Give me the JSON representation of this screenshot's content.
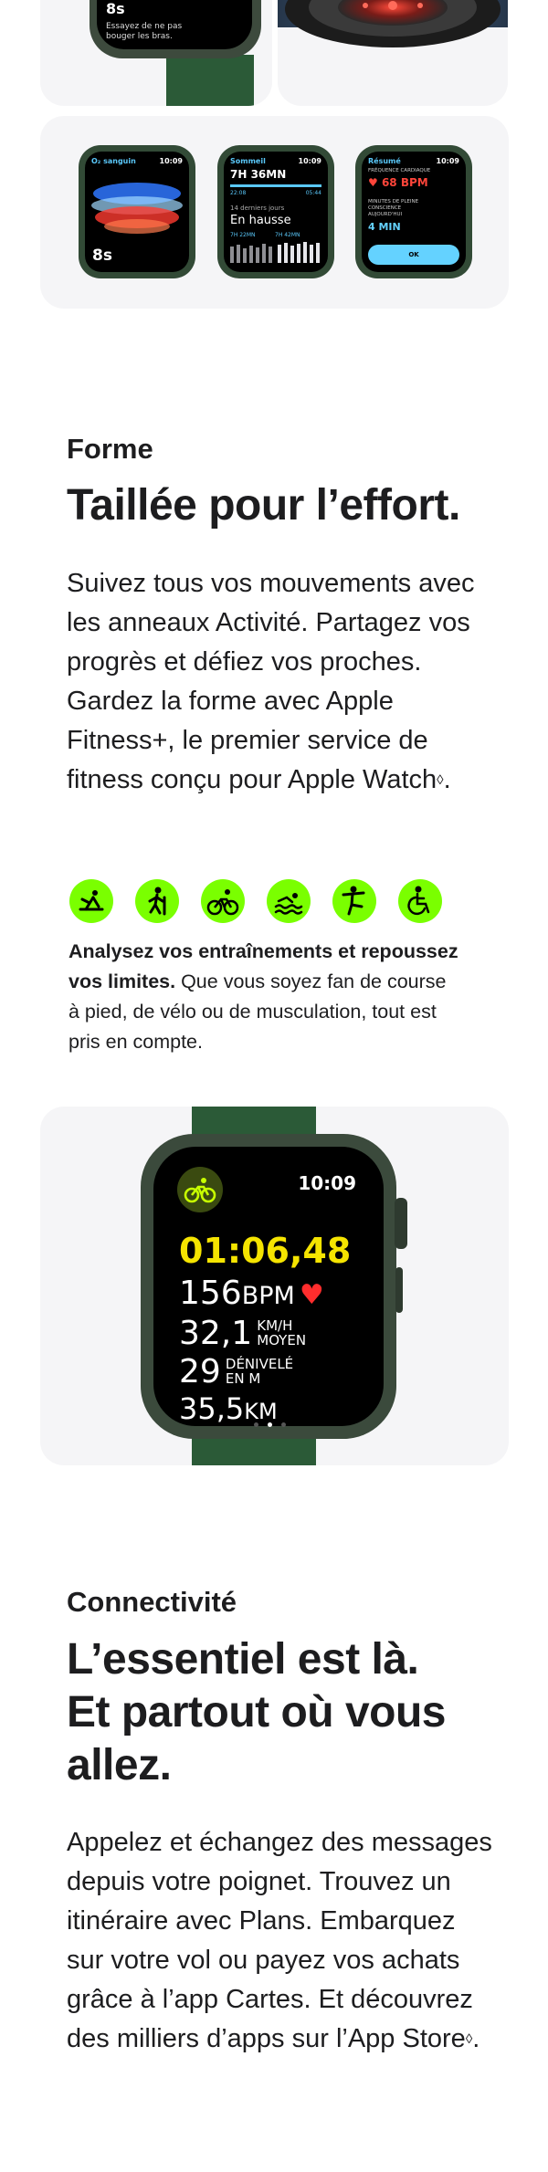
{
  "top_card_left": {
    "timer": "8s",
    "hint": "Essayez de ne pas bouger les bras."
  },
  "small_watches": [
    {
      "title": "O₂ sanguin",
      "time": "10:09",
      "timer": "8s"
    },
    {
      "title": "Sommeil",
      "time": "10:09",
      "duration": "7H 36MN",
      "range_start": "22:08",
      "range_end": "05:44",
      "subtitle": "14 derniers jours",
      "trend": "En hausse",
      "stat1": "7H 22MN",
      "stat2": "7H 42MN"
    },
    {
      "title": "Résumé",
      "time": "10:09",
      "label1": "FRÉQUENCE CARDIAQUE",
      "bpm": "68 BPM",
      "label2": "MINUTES DE PLEINE CONSCIENCE AUJOURD'HUI",
      "minutes": "4 MIN",
      "button": "OK"
    }
  ],
  "fitness": {
    "eyebrow": "Forme",
    "headline": "Taillée pour l’effort.",
    "body": "Suivez tous vos mouvements avec les anneaux Activité. Partagez vos progrès et défiez vos proches. Gardez la forme avec Apple Fitness+, le premier service de fitness conçu pour Apple Watch",
    "body_mark": "◊",
    "body_end": ".",
    "icons": [
      "yoga-icon",
      "hiking-icon",
      "cycling-icon",
      "swimming-icon",
      "dance-icon",
      "wheelchair-icon"
    ],
    "caption_bold": "Analysez vos entraînements et repoussez vos limites.",
    "caption_rest": " Que vous soyez fan de course à pied, de vélo ou de musculation, tout est pris en compte."
  },
  "workout_watch": {
    "time": "10:09",
    "elapsed": "01:06,48",
    "bpm_value": "156",
    "bpm_unit": "BPM",
    "speed_value": "32,1",
    "speed_unit_top": "KM/H",
    "speed_unit_bottom": "MOYEN",
    "elevation_value": "29",
    "elevation_unit_top": "DÉNIVELÉ",
    "elevation_unit_bottom": "EN M",
    "distance_value": "35,5",
    "distance_unit": "KM"
  },
  "connectivity": {
    "eyebrow": "Connectivité",
    "headline_lines": [
      "L’essentiel est là.",
      "Et partout où vous",
      "allez."
    ],
    "body": "Appelez et échangez des messages depuis votre poignet. Trouvez un itinéraire avec Plans. Embarquez sur votre vol ou payez vos achats grâce à l’app Cartes. Et découvrez des milliers d’apps sur l’App Store",
    "body_mark": "◊",
    "body_end": "."
  },
  "colors": {
    "card_bg": "#f5f5f7",
    "accent_green": "#7aff00",
    "workout_yellow": "#f5e400",
    "band_green": "#2b5a37",
    "heart_red": "#ff2d2d"
  }
}
